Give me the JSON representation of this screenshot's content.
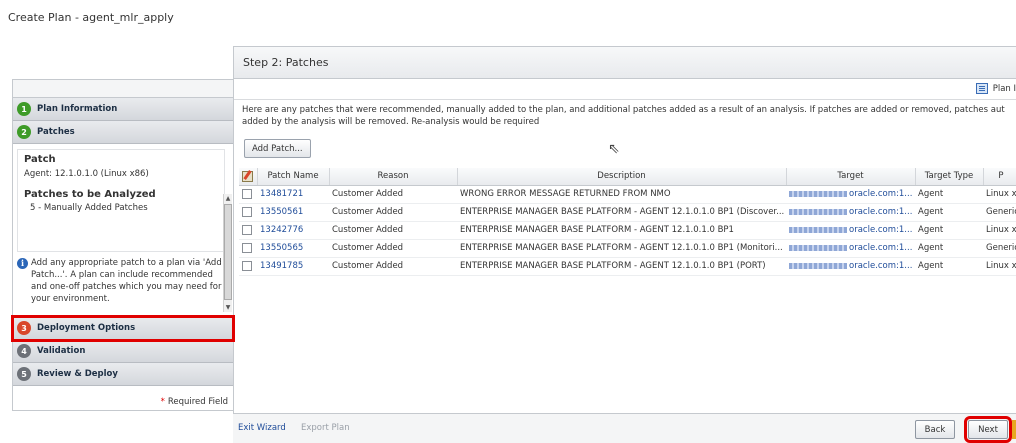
{
  "page_title": "Create Plan - agent_mlr_apply",
  "left_panel": {
    "steps": [
      {
        "num": "1",
        "label": "Plan Information",
        "color": "#3e9b28"
      },
      {
        "num": "2",
        "label": "Patches",
        "color": "#3e9b28"
      },
      {
        "num": "3",
        "label": "Deployment Options",
        "color": "#d9472b"
      },
      {
        "num": "4",
        "label": "Validation",
        "color": "#6d7178"
      },
      {
        "num": "5",
        "label": "Review & Deploy",
        "color": "#6d7178"
      }
    ],
    "patch_heading": "Patch",
    "patch_agent": "Agent: 12.1.0.1.0 (Linux x86)",
    "analyzed_heading": "Patches to be Analyzed",
    "analyzed_text": "5 - Manually Added Patches",
    "info_text": "Add any appropriate patch to a plan via 'Add Patch...'. A plan can include recommended and one-off patches which you may need for your environment.",
    "required_field": "Required Field"
  },
  "main": {
    "step_title": "Step 2: Patches",
    "plan_link": "Plan I",
    "description_line1": "Here are any patches that were recommended, manually added to the plan, and additional patches added as a result of an analysis. If patches are added or removed, patches aut",
    "description_line2": "added by the analysis will be removed. Re-analysis would be required",
    "add_patch_label": "Add Patch...",
    "columns": [
      "Patch Name",
      "Reason",
      "Description",
      "Target",
      "Target Type",
      "P"
    ],
    "rows": [
      {
        "patch": "13481721",
        "reason": "Customer Added",
        "description": "WRONG ERROR MESSAGE RETURNED FROM NMO",
        "target": "oracle.com:1...",
        "type": "Agent",
        "platform": "Linux x8"
      },
      {
        "patch": "13550561",
        "reason": "Customer Added",
        "description": "ENTERPRISE MANAGER BASE PLATFORM - AGENT 12.1.0.1.0 BP1 (Discover...",
        "target": "oracle.com:1...",
        "type": "Agent",
        "platform": "Generic"
      },
      {
        "patch": "13242776",
        "reason": "Customer Added",
        "description": "ENTERPRISE MANAGER BASE PLATFORM - AGENT 12.1.0.1.0 BP1",
        "target": "oracle.com:1...",
        "type": "Agent",
        "platform": "Linux x8"
      },
      {
        "patch": "13550565",
        "reason": "Customer Added",
        "description": "ENTERPRISE MANAGER BASE PLATFORM - AGENT 12.1.0.1.0 BP1 (Monitori...",
        "target": "oracle.com:1...",
        "type": "Agent",
        "platform": "Generic"
      },
      {
        "patch": "13491785",
        "reason": "Customer Added",
        "description": "ENTERPRISE MANAGER BASE PLATFORM - AGENT 12.1.0.1.0 BP1 (PORT)",
        "target": "oracle.com:1...",
        "type": "Agent",
        "platform": "Linux x8"
      }
    ],
    "footer": {
      "exit_wizard": "Exit Wizard",
      "export_plan": "Export Plan",
      "back": "Back",
      "next": "Next"
    }
  }
}
